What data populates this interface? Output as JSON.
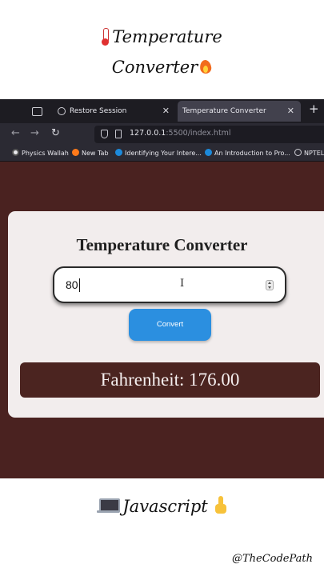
{
  "headline": {
    "line1": "Temperature",
    "line2": "Converter"
  },
  "browser": {
    "tabs": [
      {
        "label": "Restore Session",
        "active": false
      },
      {
        "label": "Temperature Converter",
        "active": true
      }
    ],
    "close_glyph": "✕",
    "new_tab_glyph": "+",
    "nav": {
      "back": "←",
      "forward": "→",
      "reload": "↻"
    },
    "url": {
      "host": "127.0.0.1",
      "rest": ":5500/index.html"
    },
    "bookmarks": [
      {
        "label": "Physics Wallah",
        "icon": "physics-wallah-icon"
      },
      {
        "label": "New Tab",
        "icon": "firefox-icon"
      },
      {
        "label": "Identifying Your Intere...",
        "icon": "coursera-icon"
      },
      {
        "label": "An Introduction to Pro...",
        "icon": "coursera-icon"
      },
      {
        "label": "NPTEL",
        "icon": "globe-icon"
      }
    ]
  },
  "app": {
    "title": "Temperature Converter",
    "input_value": "80",
    "convert_label": "Convert",
    "result": "Fahrenheit: 176.00",
    "colors": {
      "page_bg": "#4a2220",
      "card_bg": "#f2eded",
      "button": "#2b8fe0",
      "result_bg": "#4b2420"
    }
  },
  "footer": {
    "tech": "Javascript",
    "handle": "@TheCodePath"
  }
}
